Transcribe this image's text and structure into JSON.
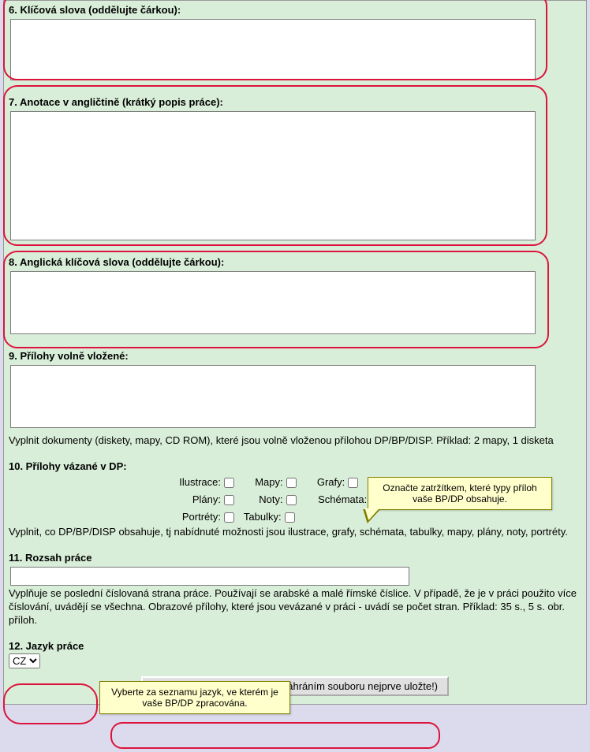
{
  "sections": {
    "s6": {
      "label": "6. Klíčová slova (oddělujte čárkou):"
    },
    "s7": {
      "label": "7. Anotace v angličtině (krátký popis práce):"
    },
    "s8": {
      "label": "8. Anglická klíčová slova (oddělujte čárkou):"
    },
    "s9": {
      "label": "9. Přílohy volně vložené:",
      "hint": "Vyplnit dokumenty (diskety, mapy, CD ROM), které jsou volně vloženou přílohou DP/BP/DISP. Příklad: 2 mapy, 1 disketa"
    },
    "s10": {
      "label": "10. Přílohy vázané v DP:",
      "items": {
        "ilustrace": "Ilustrace:",
        "mapy": "Mapy:",
        "grafy": "Grafy:",
        "plany": "Plány:",
        "noty": "Noty:",
        "schemata": "Schémata:",
        "portrety": "Portréty:",
        "tabulky": "Tabulky:"
      },
      "hint": "Vyplnit, co DP/BP/DISP obsahuje, tj nabídnuté možnosti jsou ilustrace, grafy, schémata, tabulky, mapy, plány, noty, portréty."
    },
    "s11": {
      "label": "11. Rozsah práce",
      "hint": "Vyplňuje se poslední číslovaná strana práce. Používají se arabské a malé římské číslice. V případě, že je v práci použito více číslování, uvádějí se všechna. Obrazové přílohy, které jsou vevázané v práci - uvádí se počet stran. Příklad: 35 s., 5 s. obr. příloh."
    },
    "s12": {
      "label": "12. Jazyk práce",
      "selected": "CZ"
    }
  },
  "tooltips": {
    "attachments": "Označte zatržítkem, které typy příloh vaše BP/DP obsahuje.",
    "language": "Vyberte za seznamu jazyk, ve kterém je vaše BP/DP zpracována."
  },
  "buttons": {
    "save": "Uložit data (před případným náhráním souboru nejprve uložte!)"
  }
}
